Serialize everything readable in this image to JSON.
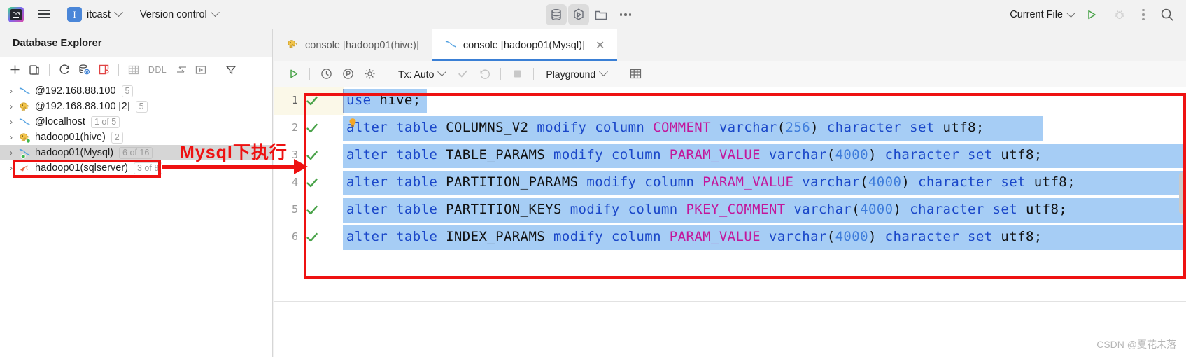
{
  "topbar": {
    "logo_icon": "datagrip-logo-icon",
    "menu_icon": "hamburger-menu-icon",
    "project_initial": "I",
    "project_name": "itcast",
    "vcs_label": "Version control",
    "center_icons": [
      "database-icon",
      "run-console-icon",
      "folder-icon",
      "more-dots-icon"
    ],
    "run_config_label": "Current File",
    "run_icon": "run-play-icon",
    "debug_icon": "debug-bug-icon",
    "more_icon": "more-vertical-icon",
    "search_icon": "search-icon"
  },
  "database_explorer": {
    "title": "Database Explorer",
    "toolbar_icons": [
      "add-icon",
      "duplicate-icon",
      "refresh-icon",
      "database-settings-icon",
      "new-query-console-icon",
      "table-icon",
      "ddl-label",
      "import-data-icon",
      "open-console-icon",
      "filter-icon"
    ],
    "ddl_label": "DDL",
    "tree": [
      {
        "label": "@192.168.88.100",
        "badge": "5",
        "icon": "mysql-dolphin-icon",
        "selected": false,
        "connected": false
      },
      {
        "label": "@192.168.88.100 [2]",
        "badge": "5",
        "icon": "hive-elephant-icon",
        "selected": false,
        "connected": false
      },
      {
        "label": "@localhost",
        "badge": "1 of 5",
        "icon": "mysql-dolphin-icon",
        "selected": false,
        "connected": false
      },
      {
        "label": "hadoop01(hive)",
        "badge": "2",
        "icon": "hive-elephant-icon",
        "selected": false,
        "connected": true
      },
      {
        "label": "hadoop01(Mysql)",
        "badge": "6 of 16",
        "icon": "mysql-dolphin-icon",
        "selected": true,
        "connected": true
      },
      {
        "label": "hadoop01(sqlserver)",
        "badge": "3 of 8",
        "icon": "sqlserver-icon",
        "selected": false,
        "connected": false
      }
    ]
  },
  "annotation": {
    "text": "Mysql下执行",
    "color": "#ee1111"
  },
  "editor": {
    "tabs": [
      {
        "label": "console [hadoop01(hive)]",
        "icon": "hive-elephant-icon",
        "active": false,
        "closable": false
      },
      {
        "label": "console [hadoop01(Mysql)]",
        "icon": "mysql-dolphin-icon",
        "active": true,
        "closable": true
      }
    ],
    "toolbar": {
      "execute_icon": "execute-play-icon",
      "history_icon": "history-clock-icon",
      "parameters_icon": "parameters-icon",
      "settings_icon": "settings-gear-icon",
      "tx_label": "Tx: Auto",
      "commit_icon": "commit-check-icon",
      "rollback_icon": "rollback-icon",
      "stop_icon": "stop-square-icon",
      "schema_label": "Playground",
      "grid_icon": "data-grid-icon"
    },
    "lines": [
      {
        "number": "1",
        "status": "success",
        "tokens": [
          {
            "t": "use",
            "c": "kw"
          },
          {
            "t": " ",
            "c": "pn"
          },
          {
            "t": "hive",
            "c": "id"
          },
          {
            "t": ";",
            "c": "pn"
          }
        ],
        "raw": "use hive;",
        "current": true,
        "sel_width": 120
      },
      {
        "number": "2",
        "status": "success",
        "tokens": [
          {
            "t": "alter",
            "c": "kw"
          },
          {
            "t": " ",
            "c": "pn"
          },
          {
            "t": "table",
            "c": "kw"
          },
          {
            "t": " ",
            "c": "pn"
          },
          {
            "t": "COLUMNS_V2",
            "c": "id"
          },
          {
            "t": " ",
            "c": "pn"
          },
          {
            "t": "modify",
            "c": "kw"
          },
          {
            "t": " ",
            "c": "pn"
          },
          {
            "t": "column",
            "c": "kw"
          },
          {
            "t": " ",
            "c": "pn"
          },
          {
            "t": "COMMENT",
            "c": "col"
          },
          {
            "t": " ",
            "c": "pn"
          },
          {
            "t": "varchar",
            "c": "kw"
          },
          {
            "t": "(",
            "c": "pn"
          },
          {
            "t": "256",
            "c": "num"
          },
          {
            "t": ")",
            "c": "pn"
          },
          {
            "t": " ",
            "c": "pn"
          },
          {
            "t": "character",
            "c": "kw"
          },
          {
            "t": " ",
            "c": "pn"
          },
          {
            "t": "set",
            "c": "kw"
          },
          {
            "t": " ",
            "c": "pn"
          },
          {
            "t": "utf8",
            "c": "id"
          },
          {
            "t": ";",
            "c": "pn"
          }
        ],
        "raw": "alter table COLUMNS_V2 modify column COMMENT varchar(256) character set utf8;",
        "hint": "intention-bulb-icon",
        "current": false,
        "sel_width": 1001
      },
      {
        "number": "3",
        "status": "success",
        "tokens": [
          {
            "t": "alter",
            "c": "kw"
          },
          {
            "t": " ",
            "c": "pn"
          },
          {
            "t": "table",
            "c": "kw"
          },
          {
            "t": " ",
            "c": "pn"
          },
          {
            "t": "TABLE_PARAMS",
            "c": "id"
          },
          {
            "t": " ",
            "c": "pn"
          },
          {
            "t": "modify",
            "c": "kw"
          },
          {
            "t": " ",
            "c": "pn"
          },
          {
            "t": "column",
            "c": "kw"
          },
          {
            "t": " ",
            "c": "pn"
          },
          {
            "t": "PARAM_VALUE",
            "c": "col"
          },
          {
            "t": " ",
            "c": "pn"
          },
          {
            "t": "varchar",
            "c": "kw"
          },
          {
            "t": "(",
            "c": "pn"
          },
          {
            "t": "4000",
            "c": "num"
          },
          {
            "t": ")",
            "c": "pn"
          },
          {
            "t": " ",
            "c": "pn"
          },
          {
            "t": "character",
            "c": "kw"
          },
          {
            "t": " ",
            "c": "pn"
          },
          {
            "t": "set",
            "c": "kw"
          },
          {
            "t": " ",
            "c": "pn"
          },
          {
            "t": "utf8",
            "c": "id"
          },
          {
            "t": ";",
            "c": "pn"
          }
        ],
        "raw": "alter table TABLE_PARAMS modify column PARAM_VALUE varchar(4000) character set utf8;",
        "current": false,
        "sel_width": 1304
      },
      {
        "number": "4",
        "status": "success",
        "tokens": [
          {
            "t": "alter",
            "c": "kw"
          },
          {
            "t": " ",
            "c": "pn"
          },
          {
            "t": "table",
            "c": "kw"
          },
          {
            "t": " ",
            "c": "pn"
          },
          {
            "t": "PARTITION_PARAMS",
            "c": "id"
          },
          {
            "t": " ",
            "c": "pn"
          },
          {
            "t": "modify",
            "c": "kw"
          },
          {
            "t": " ",
            "c": "pn"
          },
          {
            "t": "column",
            "c": "kw"
          },
          {
            "t": " ",
            "c": "pn"
          },
          {
            "t": "PARAM_VALUE",
            "c": "col"
          },
          {
            "t": " ",
            "c": "pn"
          },
          {
            "t": "varchar",
            "c": "kw"
          },
          {
            "t": "(",
            "c": "pn"
          },
          {
            "t": "4000",
            "c": "num"
          },
          {
            "t": ")",
            "c": "pn"
          },
          {
            "t": " ",
            "c": "pn"
          },
          {
            "t": "character",
            "c": "kw"
          },
          {
            "t": " ",
            "c": "pn"
          },
          {
            "t": "set",
            "c": "kw"
          },
          {
            "t": " ",
            "c": "pn"
          },
          {
            "t": "utf8",
            "c": "id"
          },
          {
            "t": ";",
            "c": "pn"
          }
        ],
        "raw": "alter table PARTITION_PARAMS modify column PARAM_VALUE varchar(4000) character set utf8;",
        "current": false,
        "sel_width": 1304
      },
      {
        "number": "5",
        "status": "success",
        "tokens": [
          {
            "t": "alter",
            "c": "kw"
          },
          {
            "t": " ",
            "c": "pn"
          },
          {
            "t": "table",
            "c": "kw"
          },
          {
            "t": " ",
            "c": "pn"
          },
          {
            "t": "PARTITION_KEYS",
            "c": "id"
          },
          {
            "t": " ",
            "c": "pn"
          },
          {
            "t": "modify",
            "c": "kw"
          },
          {
            "t": " ",
            "c": "pn"
          },
          {
            "t": "column",
            "c": "kw"
          },
          {
            "t": " ",
            "c": "pn"
          },
          {
            "t": "PKEY_COMMENT",
            "c": "col"
          },
          {
            "t": " ",
            "c": "pn"
          },
          {
            "t": "varchar",
            "c": "kw"
          },
          {
            "t": "(",
            "c": "pn"
          },
          {
            "t": "4000",
            "c": "num"
          },
          {
            "t": ")",
            "c": "pn"
          },
          {
            "t": " ",
            "c": "pn"
          },
          {
            "t": "character",
            "c": "kw"
          },
          {
            "t": " ",
            "c": "pn"
          },
          {
            "t": "set",
            "c": "kw"
          },
          {
            "t": " ",
            "c": "pn"
          },
          {
            "t": "utf8",
            "c": "id"
          },
          {
            "t": ";",
            "c": "pn"
          }
        ],
        "raw": "alter table PARTITION_KEYS modify column PKEY_COMMENT varchar(4000) character set utf8;",
        "current": false,
        "sel_width": 1304
      },
      {
        "number": "6",
        "status": "success",
        "tokens": [
          {
            "t": "alter",
            "c": "kw"
          },
          {
            "t": " ",
            "c": "pn"
          },
          {
            "t": "table",
            "c": "kw"
          },
          {
            "t": " ",
            "c": "pn"
          },
          {
            "t": "INDEX_PARAMS",
            "c": "id"
          },
          {
            "t": " ",
            "c": "pn"
          },
          {
            "t": "modify",
            "c": "kw"
          },
          {
            "t": " ",
            "c": "pn"
          },
          {
            "t": "column",
            "c": "kw"
          },
          {
            "t": " ",
            "c": "pn"
          },
          {
            "t": "PARAM_VALUE",
            "c": "col"
          },
          {
            "t": " ",
            "c": "pn"
          },
          {
            "t": "varchar",
            "c": "kw"
          },
          {
            "t": "(",
            "c": "pn"
          },
          {
            "t": "4000",
            "c": "num"
          },
          {
            "t": ")",
            "c": "pn"
          },
          {
            "t": " ",
            "c": "pn"
          },
          {
            "t": "character",
            "c": "kw"
          },
          {
            "t": " ",
            "c": "pn"
          },
          {
            "t": "set",
            "c": "kw"
          },
          {
            "t": " ",
            "c": "pn"
          },
          {
            "t": "utf8",
            "c": "id"
          },
          {
            "t": ";",
            "c": "pn"
          }
        ],
        "raw": "alter table INDEX_PARAMS modify column PARAM_VALUE varchar(4000) character set utf8;",
        "current": false,
        "sel_width": 1304
      }
    ]
  },
  "watermark": "CSDN @夏花未落"
}
